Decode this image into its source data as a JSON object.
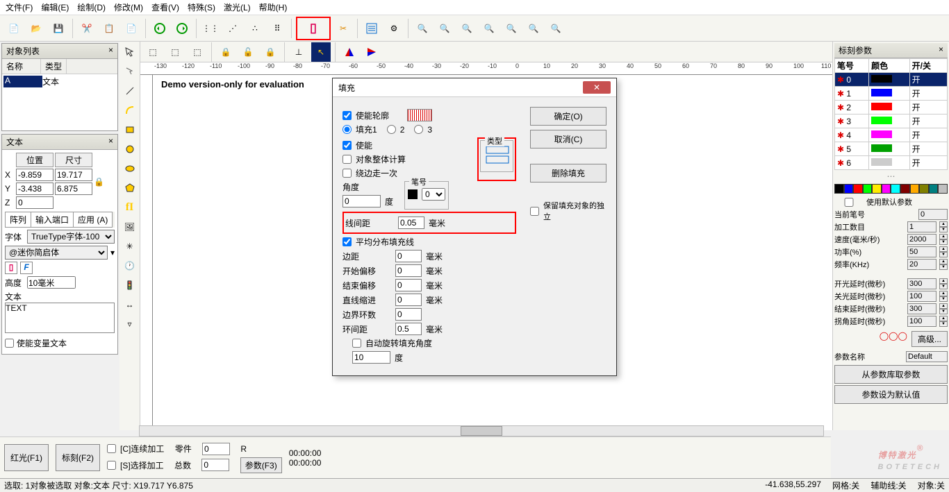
{
  "menu": {
    "file": "文件(F)",
    "edit": "编辑(E)",
    "draw": "绘制(D)",
    "modify": "修改(M)",
    "view": "查看(V)",
    "special": "特殊(S)",
    "laser": "激光(L)",
    "help": "帮助(H)"
  },
  "panels": {
    "objlist": {
      "title": "对象列表",
      "col_name": "名称",
      "col_type": "类型",
      "row_name": "A",
      "row_type": "文本"
    },
    "text": {
      "title": "文本",
      "pos": "位置",
      "size": "尺寸",
      "x": "X",
      "y": "Y",
      "z": "Z",
      "xv": "-9.859",
      "yv": "-3.438",
      "zv": "0",
      "wv": "19.717",
      "hv": "6.875",
      "tab_array": "阵列",
      "tab_io": "输入端口",
      "tab_apply": "应用 (A)",
      "font_lbl": "字体",
      "font_val": "TrueType字体-100",
      "fontname": "@迷你简启体",
      "height_lbl": "高度",
      "height_val": "10毫米",
      "text_lbl": "文本",
      "text_val": "TEXT",
      "cb_var": "使能变量文本"
    },
    "mark": {
      "title": "标刻参数",
      "pen": "笔号",
      "color": "颜色",
      "onoff": "开/关",
      "on": "开",
      "cb_default": "使用默认参数",
      "cur_pen": "当前笔号",
      "cur_pen_v": "0",
      "count": "加工数目",
      "count_v": "1",
      "speed": "速度(毫米/秒)",
      "speed_v": "2000",
      "power": "功率(%)",
      "power_v": "50",
      "freq": "频率(KHz)",
      "freq_v": "20",
      "on_delay": "开光延时(微秒)",
      "on_delay_v": "300",
      "off_delay": "关光延时(微秒)",
      "off_delay_v": "100",
      "end_delay": "结束延时(微秒)",
      "end_delay_v": "300",
      "corner_delay": "拐角延时(微秒)",
      "corner_delay_v": "100",
      "adv": "高级...",
      "param_name_lbl": "参数名称",
      "param_name_v": "Default",
      "from_lib": "从参数库取参数",
      "set_default": "参数设为默认值"
    }
  },
  "dialog": {
    "title": "填充",
    "ok": "确定(O)",
    "cancel": "取消(C)",
    "del": "删除填充",
    "cb_contour": "使能轮廓",
    "fill1": "填充1",
    "r2": "2",
    "r3": "3",
    "cb_enable": "使能",
    "cb_whole": "对象整体计算",
    "cb_around": "绕边走一次",
    "type_leg": "类型",
    "angle_lbl": "角度",
    "angle_v": "0",
    "deg": "度",
    "pen_leg": "笔号",
    "pen_v": "0",
    "cb_keep": "保留填充对象的独立",
    "line_sp": "线间距",
    "line_sp_v": "0.05",
    "mm": "毫米",
    "cb_avg": "平均分布填充线",
    "edge": "边距",
    "edge_v": "0",
    "start_off": "开始偏移",
    "start_off_v": "0",
    "end_off": "结束偏移",
    "end_off_v": "0",
    "line_red": "直线缩进",
    "line_red_v": "0",
    "loops": "边界环数",
    "loops_v": "0",
    "ring": "环间距",
    "ring_v": "0.5",
    "cb_rotate": "自动旋转填充角度",
    "rotate_v": "10"
  },
  "bottom": {
    "red": "红光(F1)",
    "mark": "标刻(F2)",
    "cb_cont": "[C]连续加工",
    "cb_sel": "[S]选择加工",
    "parts": "零件",
    "parts_v": "0",
    "r": "R",
    "total": "总数",
    "total_v": "0",
    "param": "参数(F3)",
    "t1": "00:00:00",
    "t2": "00:00:00"
  },
  "status": {
    "left": "选取: 1对象被选取 对象:文本 尺寸: X19.717 Y6.875",
    "coord": "-41.638,55.297",
    "grid": "网格:关",
    "snap": "辅助线:关",
    "obj": "对象:关"
  },
  "canvas": {
    "demo": "Demo version-only for evaluation"
  },
  "ruler_ticks": [
    "-130",
    "-120",
    "-110",
    "-100",
    "-90",
    "-80",
    "-70",
    "-60",
    "-50",
    "-40",
    "-30",
    "-20",
    "-10",
    "0",
    "10",
    "20",
    "30",
    "40",
    "50",
    "60",
    "70",
    "80",
    "90",
    "100",
    "110"
  ],
  "pens": [
    {
      "n": "0",
      "c": "#000000"
    },
    {
      "n": "1",
      "c": "#0000ff"
    },
    {
      "n": "2",
      "c": "#ff0000"
    },
    {
      "n": "3",
      "c": "#00ff00"
    },
    {
      "n": "4",
      "c": "#ff00ff"
    },
    {
      "n": "5",
      "c": "#00a000"
    },
    {
      "n": "6",
      "c": "#cccccc"
    }
  ],
  "palette": [
    "#000",
    "#00f",
    "#f00",
    "#0f0",
    "#ffeb00",
    "#f0f",
    "#0ff",
    "#800000",
    "#fa0",
    "#808000",
    "#008080",
    "#c0c0c0"
  ],
  "watermark": {
    "main": "博特激光",
    "sub": "BOTETECH",
    "r": "®"
  }
}
